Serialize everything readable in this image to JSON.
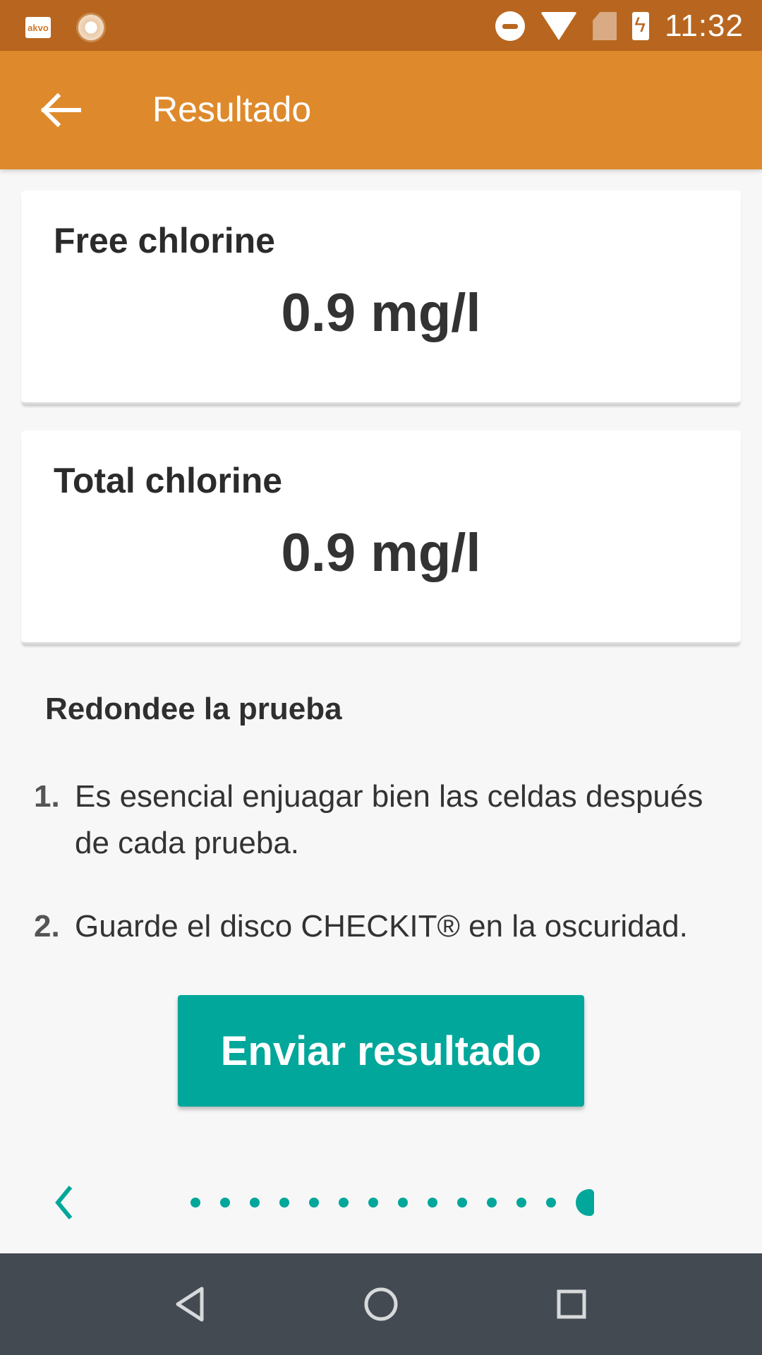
{
  "status_bar": {
    "time": "11:32",
    "left_icons": [
      "akvo-app-icon",
      "caddisfly-app-icon"
    ],
    "right_icons": [
      "do-not-disturb-icon",
      "wifi-icon",
      "no-sim-icon",
      "battery-charging-icon"
    ],
    "akvo_label": "akvo"
  },
  "app_bar": {
    "title": "Resultado",
    "back_icon": "arrow-left-icon"
  },
  "results": [
    {
      "name": "Free chlorine",
      "value": "0.9 mg/l"
    },
    {
      "name": "Total chlorine",
      "value": "0.9 mg/l"
    }
  ],
  "instructions": {
    "title": "Redondee la prueba",
    "steps": [
      {
        "num": "1.",
        "text": "Es esencial enjuagar bien las celdas después de cada prueba."
      },
      {
        "num": "2.",
        "text": "Guarde el disco CHECKIT® en la oscuridad."
      }
    ]
  },
  "send_button": {
    "label": "Enviar resultado"
  },
  "pager": {
    "prev_icon": "chevron-left-icon",
    "total_pages": 14,
    "current_page": 14
  },
  "colors": {
    "status_bar": "#b8661f",
    "app_bar": "#de8a2c",
    "accent": "#00a79a",
    "nav_bar": "#434a52"
  },
  "nav_bar": {
    "buttons": [
      "back-triangle-icon",
      "home-circle-icon",
      "recents-square-icon"
    ]
  }
}
